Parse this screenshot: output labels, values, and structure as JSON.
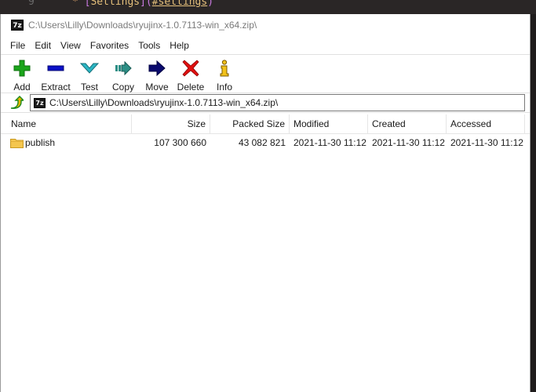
{
  "background": {
    "line_number": "9",
    "code_star": "*",
    "code_link_open": "[",
    "code_link_text": "Settings",
    "code_link_close": "]",
    "code_paren_open": "(",
    "code_href": "#settings",
    "code_paren_close": ")"
  },
  "window": {
    "app_icon_text": "7z",
    "title": "C:\\Users\\Lilly\\Downloads\\ryujinx-1.0.7113-win_x64.zip\\"
  },
  "menu": [
    "File",
    "Edit",
    "View",
    "Favorites",
    "Tools",
    "Help"
  ],
  "toolbar": [
    {
      "label": "Add",
      "icon": "add-icon"
    },
    {
      "label": "Extract",
      "icon": "extract-icon"
    },
    {
      "label": "Test",
      "icon": "test-icon"
    },
    {
      "label": "Copy",
      "icon": "copy-icon"
    },
    {
      "label": "Move",
      "icon": "move-icon"
    },
    {
      "label": "Delete",
      "icon": "delete-icon"
    },
    {
      "label": "Info",
      "icon": "info-icon"
    }
  ],
  "address": {
    "icon_text": "7z",
    "path": "C:\\Users\\Lilly\\Downloads\\ryujinx-1.0.7113-win_x64.zip\\"
  },
  "columns": [
    "Name",
    "Size",
    "Packed Size",
    "Modified",
    "Created",
    "Accessed"
  ],
  "rows": [
    {
      "name": "publish",
      "size": "107 300 660",
      "packed_size": "43 082 821",
      "modified": "2021-11-30 11:12",
      "created": "2021-11-30 11:12",
      "accessed": "2021-11-30 11:12"
    }
  ],
  "colors": {
    "add": "#1aa51a",
    "extract": "#0a10c8",
    "test": "#2bb6c4",
    "copy": "#2d8f86",
    "move": "#0a0a6e",
    "delete": "#e01010",
    "info": "#f2c21a",
    "folder": "#f4c64e"
  }
}
